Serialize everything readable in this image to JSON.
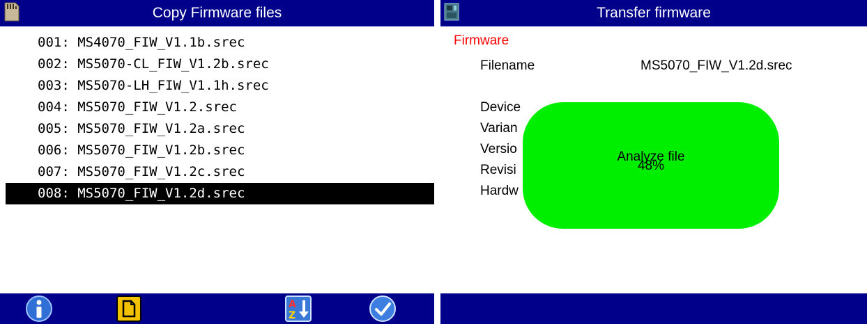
{
  "left": {
    "title": "Copy Firmware files",
    "title_icon": "sd-card-icon",
    "files": [
      "001: MS4070_FIW_V1.1b.srec",
      "002: MS5070-CL_FIW_V1.2b.srec",
      "003: MS5070-LH_FIW_V1.1h.srec",
      "004: MS5070_FIW_V1.2.srec",
      "005: MS5070_FIW_V1.2a.srec",
      "006: MS5070_FIW_V1.2b.srec",
      "007: MS5070_FIW_V1.2c.srec",
      "008: MS5070_FIW_V1.2d.srec"
    ],
    "selected_index": 7,
    "toolbar": [
      "info-icon",
      "document-icon",
      "sort-az-icon",
      "confirm-check-icon"
    ]
  },
  "right": {
    "title": "Transfer firmware",
    "title_icon": "device-icon",
    "section": "Firmware",
    "filename_label": "Filename",
    "filename_value": "MS5070_FIW_V1.2d.srec",
    "labels_truncated": [
      "Device",
      "Varian",
      "Versio",
      "Revisi",
      "Hardw"
    ],
    "progress_text": "Analyze file",
    "progress_percent": "48%",
    "progress_value": 48
  },
  "colors": {
    "titlebar": "#00008b",
    "selection": "#000000",
    "section": "#ff0000",
    "progress": "#00ee00"
  }
}
